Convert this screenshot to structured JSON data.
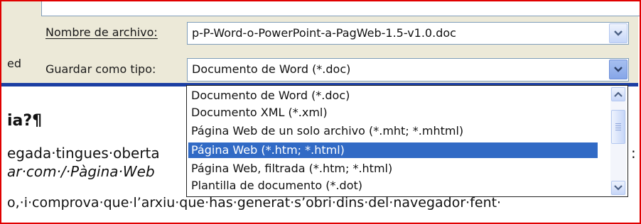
{
  "dialog": {
    "filename_label": "Nombre de archivo:",
    "filename_value": "p-P-Word-o-PowerPoint-a-PagWeb-1.5-v1.0.doc",
    "savetype_label": "Guardar como tipo:",
    "savetype_value": "Documento de Word (*.doc)",
    "left_partial_label": "ed"
  },
  "dropdown": {
    "options": [
      "Documento de Word (*.doc)",
      "Documento XML (*.xml)",
      "Página Web de un solo archivo (*.mht; *.mhtml)",
      "Página Web (*.htm; *.html)",
      "Página Web, filtrada (*.htm; *.html)",
      "Plantilla de documento (*.dot)"
    ],
    "selected_index": 3
  },
  "document": {
    "heading": "ia?¶",
    "line1": "egada·tingues·oberta",
    "line1_right": ":",
    "line2": "ar·com·/·Pàgina·Web",
    "line3": "o,·i·comprova·que·l’arxiu·que·has·generat·s’obri·dins·del·navegador·fent·"
  },
  "colors": {
    "frame": "#e00000",
    "dialog_bg": "#ece9d8",
    "selection": "#316ac5",
    "rule": "#1c3fa3"
  }
}
